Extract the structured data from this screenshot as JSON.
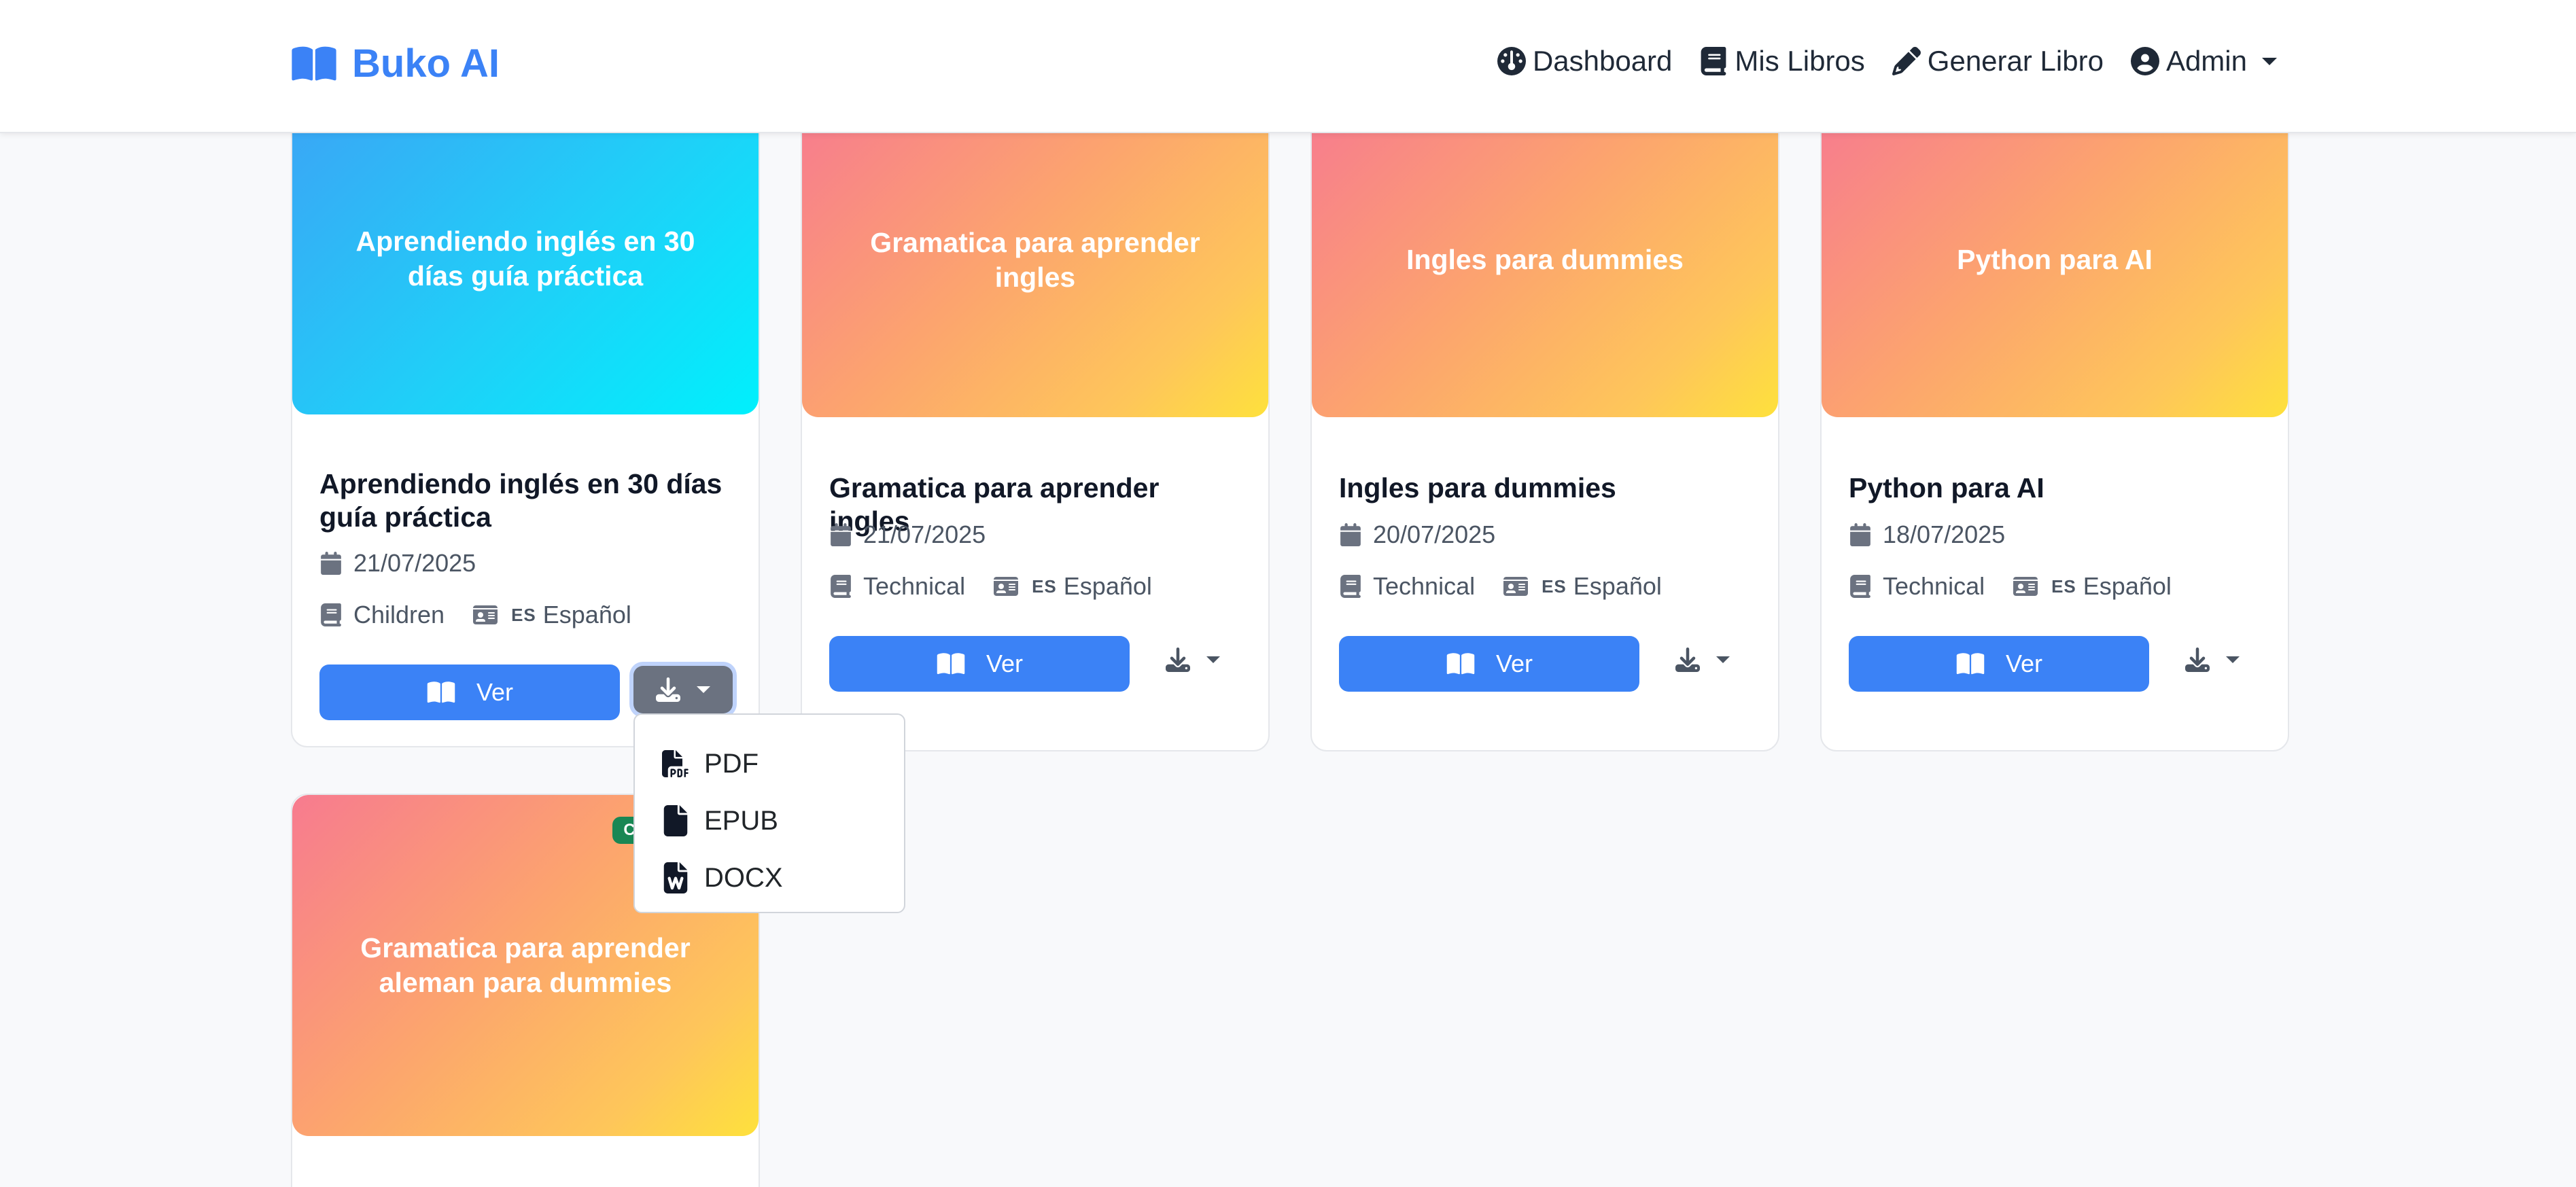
{
  "navbar": {
    "brand": "Buko AI",
    "links": {
      "dashboard": "Dashboard",
      "mis_libros": "Mis Libros",
      "generar_libro": "Generar Libro",
      "admin": "Admin"
    }
  },
  "cards": [
    {
      "cover_title": "Aprendiendo inglés en 30 días guía práctica",
      "title": "Aprendiendo inglés en 30 días guía práctica",
      "date": "21/07/2025",
      "category": "Children",
      "language_code": "ES",
      "language": "Español",
      "view_label": "Ver",
      "gradient": "#3ba5f5"
    },
    {
      "cover_title": "Gramatica para aprender ingles",
      "title": "Gramatica para aprender ingles",
      "date": "21/07/2025",
      "category": "Technical",
      "language_code": "ES",
      "language": "Español",
      "view_label": "Ver",
      "gradient": "#f77b8f"
    },
    {
      "cover_title": "Ingles para dummies",
      "title": "Ingles para dummies",
      "date": "20/07/2025",
      "category": "Technical",
      "language_code": "ES",
      "language": "Español",
      "view_label": "Ver",
      "gradient": "#f77b8f"
    },
    {
      "cover_title": "Python para AI",
      "title": "Python para AI",
      "date": "18/07/2025",
      "category": "Technical",
      "language_code": "ES",
      "language": "Español",
      "view_label": "Ver",
      "gradient": "#f77b8f"
    },
    {
      "cover_title": "Gramatica para aprender aleman para dummies",
      "status_badge": "Completado",
      "gradient": "#f77b8f"
    }
  ],
  "download_menu": {
    "items": [
      "PDF",
      "EPUB",
      "DOCX"
    ]
  },
  "colors": {
    "accent": "#3b82f6",
    "badge_success": "#198754",
    "active_button": "#6b7280"
  },
  "icons": {
    "brand": "book-open-icon",
    "dashboard": "gauge-icon",
    "mis_libros": "book-icon",
    "generar_libro": "pencil-icon",
    "admin": "user-circle-icon",
    "date": "calendar-icon",
    "category": "book-icon",
    "language": "id-card-icon",
    "view": "book-open-icon",
    "download": "download-icon",
    "pdf": "file-pdf-icon"
  }
}
